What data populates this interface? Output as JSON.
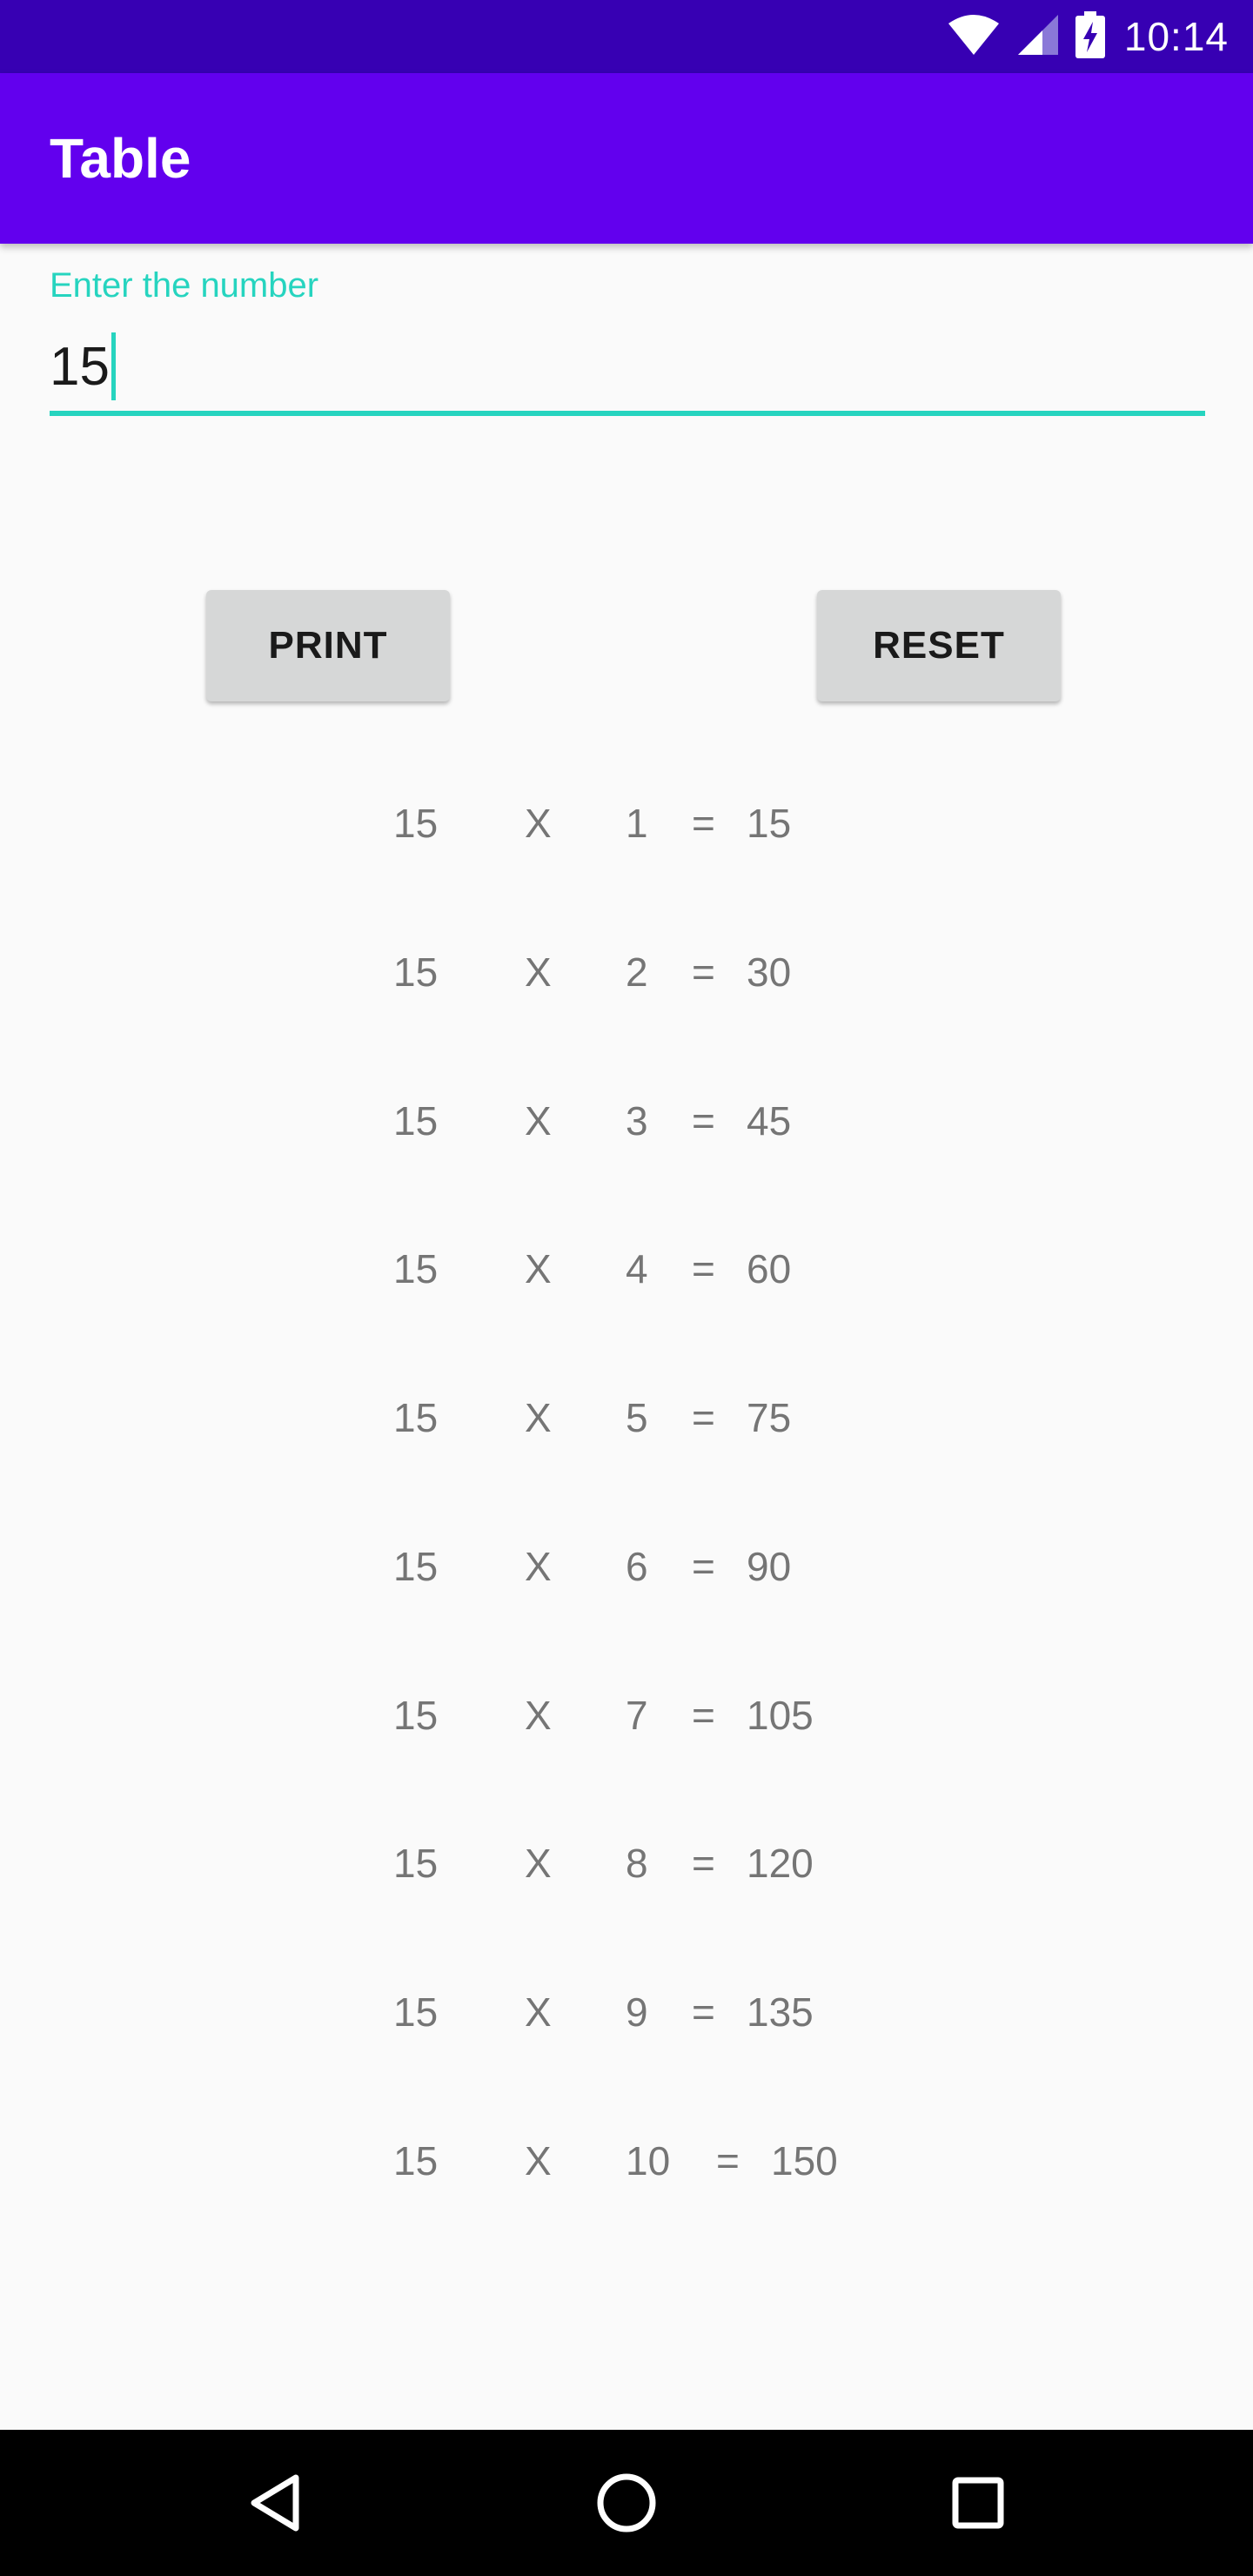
{
  "status_bar": {
    "time": "10:14",
    "icons": [
      "wifi-icon",
      "signal-icon",
      "battery-charging-icon"
    ],
    "background_color": "#3700b3"
  },
  "app_bar": {
    "title": "Table",
    "background_color": "#6200ee"
  },
  "number_field": {
    "label": "Enter the number",
    "value": "15",
    "accent_color": "#26d4bf"
  },
  "buttons": {
    "print_label": "PRINT",
    "reset_label": "RESET"
  },
  "table": {
    "rows": [
      {
        "base": "15",
        "op": "X",
        "multiplier": "1",
        "eq": "=",
        "result": "15"
      },
      {
        "base": "15",
        "op": "X",
        "multiplier": "2",
        "eq": "=",
        "result": "30"
      },
      {
        "base": "15",
        "op": "X",
        "multiplier": "3",
        "eq": "=",
        "result": "45"
      },
      {
        "base": "15",
        "op": "X",
        "multiplier": "4",
        "eq": "=",
        "result": "60"
      },
      {
        "base": "15",
        "op": "X",
        "multiplier": "5",
        "eq": "=",
        "result": "75"
      },
      {
        "base": "15",
        "op": "X",
        "multiplier": "6",
        "eq": "=",
        "result": "90"
      },
      {
        "base": "15",
        "op": "X",
        "multiplier": "7",
        "eq": "=",
        "result": "105"
      },
      {
        "base": "15",
        "op": "X",
        "multiplier": "8",
        "eq": "=",
        "result": "120"
      },
      {
        "base": "15",
        "op": "X",
        "multiplier": "9",
        "eq": "=",
        "result": "135"
      },
      {
        "base": "15",
        "op": "X",
        "multiplier": "10",
        "eq": "=",
        "result": "150"
      }
    ]
  },
  "nav_bar": {
    "icons": [
      "back-icon",
      "home-icon",
      "recents-icon"
    ]
  }
}
